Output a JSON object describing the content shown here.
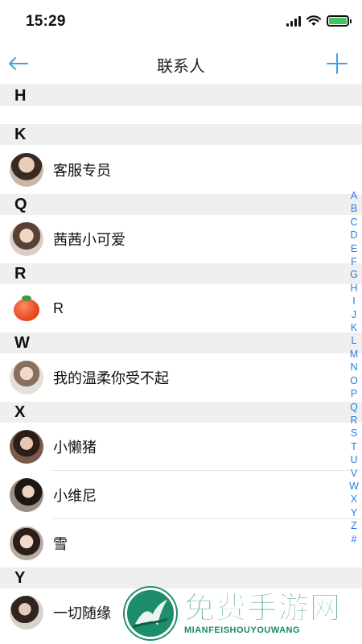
{
  "status_bar": {
    "time": "15:29",
    "battery_color": "#43c35e"
  },
  "nav": {
    "title": "联系人",
    "back_icon": "arrow-left-icon",
    "add_icon": "plus-icon",
    "accent_color": "#3aa3e8"
  },
  "sections": [
    {
      "letter": "H",
      "contacts": []
    },
    {
      "letter": "K",
      "contacts": [
        {
          "name": "客服专员",
          "avatar": "photo-avatar"
        }
      ]
    },
    {
      "letter": "Q",
      "contacts": [
        {
          "name": "茜茜小可爱",
          "avatar": "photo-avatar"
        }
      ]
    },
    {
      "letter": "R",
      "contacts": [
        {
          "name": "R",
          "avatar": "tomato-avatar"
        }
      ]
    },
    {
      "letter": "W",
      "contacts": [
        {
          "name": "我的温柔你受不起",
          "avatar": "photo-avatar"
        }
      ]
    },
    {
      "letter": "X",
      "contacts": [
        {
          "name": "小懒猪",
          "avatar": "photo-avatar"
        },
        {
          "name": "小维尼",
          "avatar": "photo-avatar"
        },
        {
          "name": "雪",
          "avatar": "photo-avatar"
        }
      ]
    },
    {
      "letter": "Y",
      "contacts": [
        {
          "name": "一切随缘",
          "avatar": "photo-avatar"
        }
      ]
    }
  ],
  "index_letters": [
    "A",
    "B",
    "C",
    "D",
    "E",
    "F",
    "G",
    "H",
    "I",
    "J",
    "K",
    "L",
    "M",
    "N",
    "O",
    "P",
    "Q",
    "R",
    "S",
    "T",
    "U",
    "V",
    "W",
    "X",
    "Y",
    "Z",
    "#"
  ],
  "index_color": "#2a7de1",
  "watermark": {
    "title": "免费手游网",
    "subtitle": "MIANFEISHOUYOUWANG",
    "color": "#1a8a67"
  }
}
